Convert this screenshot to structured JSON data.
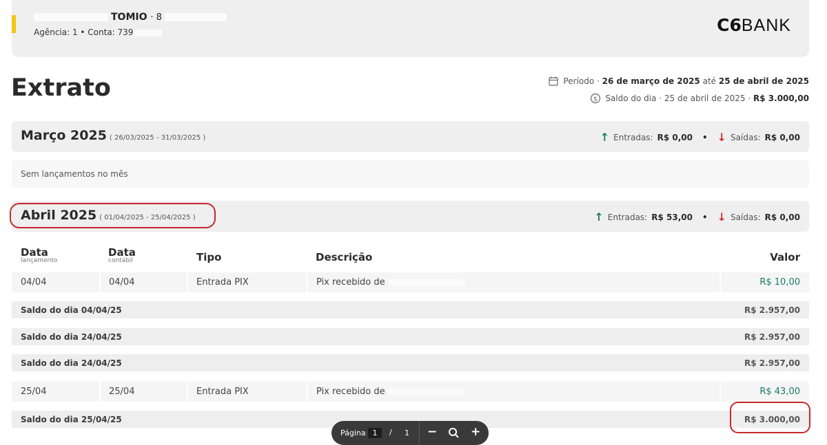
{
  "header": {
    "name": "TOMIO",
    "name_suffix": "· 8",
    "account": "Agência: 1 • Conta: 739",
    "logo_c6": "C6",
    "logo_bank": "BANK"
  },
  "page": {
    "title": "Extrato",
    "period_prefix": "Período ·",
    "period_start": "26 de março de 2025",
    "period_mid": "até",
    "period_end": "25 de abril de 2025",
    "saldo_prefix": "Saldo do dia · 25 de abril de 2025 ·",
    "saldo_value": "R$ 3.000,00"
  },
  "months": [
    {
      "name": "Março 2025",
      "range": "( 26/03/2025 - 31/03/2025 )",
      "entradas_label": "Entradas:",
      "entradas": "R$ 0,00",
      "saidas_label": "Saídas:",
      "saidas": "R$ 0,00",
      "empty_text": "Sem lançamentos no mês"
    },
    {
      "name": "Abril 2025",
      "range": "( 01/04/2025 - 25/04/2025 )",
      "entradas_label": "Entradas:",
      "entradas": "R$ 53,00",
      "saidas_label": "Saídas:",
      "saidas": "R$ 0,00"
    }
  ],
  "table": {
    "headers": {
      "data_lanc": "Data",
      "data_lanc_sub": "lançamento",
      "data_cont": "Data",
      "data_cont_sub": "contábil",
      "tipo": "Tipo",
      "descricao": "Descrição",
      "valor": "Valor"
    },
    "rows": [
      {
        "data_lanc": "04/04",
        "data_cont": "04/04",
        "tipo": "Entrada PIX",
        "descricao": "Pix recebido de",
        "valor": "R$ 10,00"
      },
      {
        "data_lanc": "25/04",
        "data_cont": "25/04",
        "tipo": "Entrada PIX",
        "descricao": "Pix recebido de",
        "valor": "R$ 43,00"
      }
    ],
    "saldos": [
      {
        "label": "Saldo do dia 04/04/25",
        "value": "R$ 2.957,00"
      },
      {
        "label": "Saldo do dia 24/04/25",
        "value": "R$ 2.957,00"
      },
      {
        "label": "Saldo do dia 24/04/25",
        "value": "R$ 2.957,00"
      },
      {
        "label": "Saldo do dia 25/04/25",
        "value": "R$ 3.000,00"
      }
    ]
  },
  "pager": {
    "label": "Página",
    "current": "1",
    "slash": "/",
    "total": "1",
    "zoom_out": "−",
    "zoom_in": "+"
  },
  "colors": {
    "accent_yellow": "#f5c518",
    "income_green": "#1a7a6b",
    "outgo_red": "#d32f2f",
    "annotation_red": "#c62828"
  }
}
